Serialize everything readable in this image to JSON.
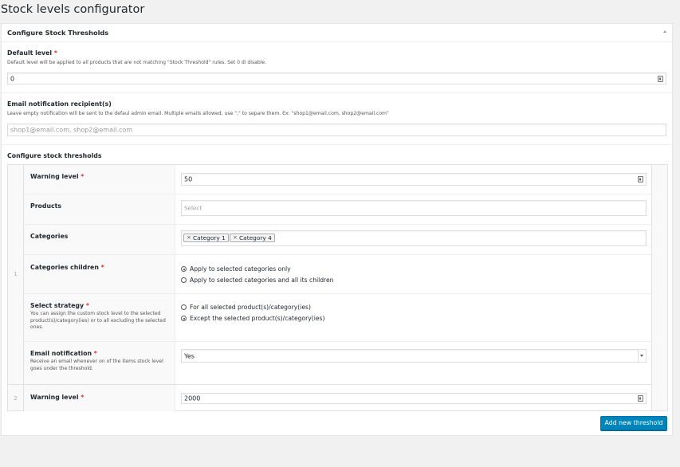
{
  "page_title": "Stock levels configurator",
  "box": {
    "title": "Configure Stock Thresholds"
  },
  "default_level": {
    "label": "Default level",
    "required": "*",
    "description": "Default level will be applied to all products that are not matching \"Stock Threshold\" rules. Set 0 di disable.",
    "value": "0"
  },
  "email_recipient": {
    "label": "Email notification recipient(s)",
    "description": "Leave empty notification will be sent to the defaul admin email. Multiple emails allowed, use \",\" to separe them. Ex: \"shop1@email.com, shop2@email.com\"",
    "placeholder": "shop1@email.com, shop2@email.com"
  },
  "thresholds": {
    "label": "Configure stock thresholds",
    "rows": [
      {
        "index": "1",
        "warning_label": "Warning level",
        "required": "*",
        "warning_value": "50",
        "products_label": "Products",
        "products_placeholder": "Select",
        "categories_label": "Categories",
        "categories": [
          "Category 1",
          "Category 4"
        ],
        "tag_remove": "×",
        "children_label": "Categories children",
        "children_options": [
          "Apply to selected categories only",
          "Apply to selected categories and all its children"
        ],
        "children_selected": 0,
        "strategy_label": "Select strategy",
        "strategy_desc": "You can assign the custom stock level to the selected product(s)/category(ies) or to all excluding the selected ones.",
        "strategy_options": [
          "For all selected product(s)/category(ies)",
          "Except the selected product(s)/category(ies)"
        ],
        "strategy_selected": 1,
        "email_label": "Email notification",
        "email_desc": "Receive an email whenever on of the items stock level goes under the threshold.",
        "email_value": "Yes"
      },
      {
        "index": "2",
        "warning_label": "Warning level",
        "required": "*",
        "warning_value": "2000"
      }
    ],
    "add_button": "Add new threshold"
  }
}
